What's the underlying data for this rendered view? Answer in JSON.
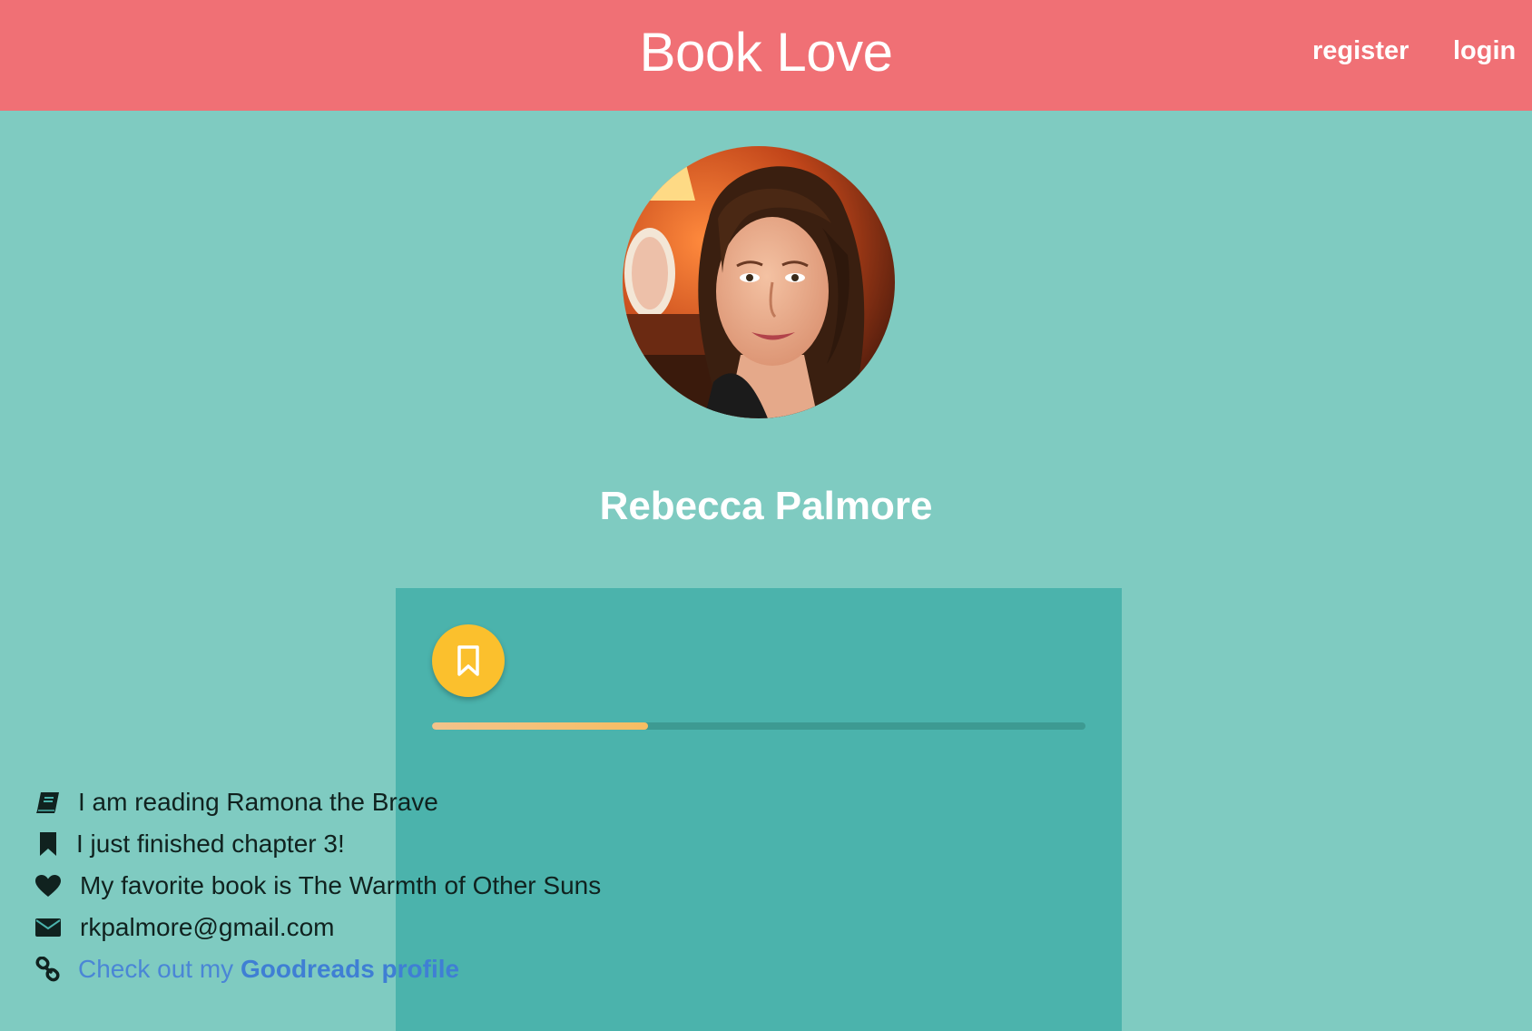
{
  "header": {
    "brand": "Book Love",
    "nav": {
      "register": "register",
      "login": "login"
    },
    "background_color": "#f07075"
  },
  "profile": {
    "name": "Rebecca Palmore",
    "avatar_icon": "avatar-photo"
  },
  "card": {
    "background_color": "#4bb3ac",
    "action_button_icon": "bookmark-outline-icon",
    "action_button_color": "#fbc02d",
    "reading_progress_percent": 33,
    "items": [
      {
        "icon": "book-icon",
        "text": "I am reading Ramona the Brave"
      },
      {
        "icon": "bookmark-icon",
        "text": "I just finished chapter 3!"
      },
      {
        "icon": "heart-icon",
        "text": "My favorite book is The Warmth of Other Suns"
      },
      {
        "icon": "envelope-icon",
        "text": "rkpalmore@gmail.com"
      },
      {
        "icon": "link-icon",
        "prefix": "Check out my ",
        "link_text": "Goodreads profile"
      }
    ]
  }
}
